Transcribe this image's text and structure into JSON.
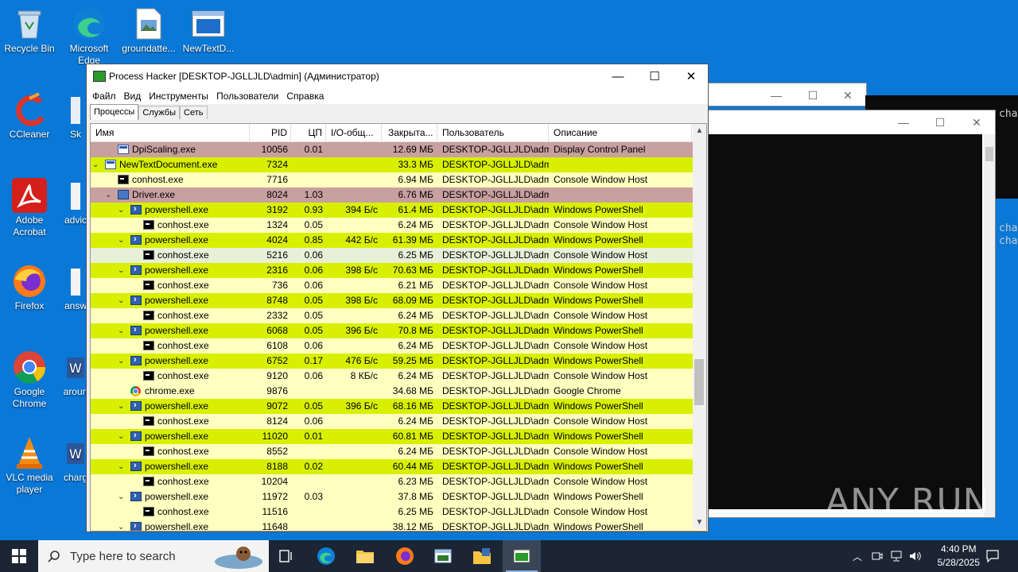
{
  "desktop": {
    "icons": [
      {
        "label": "Recycle Bin"
      },
      {
        "label": "Microsoft Edge"
      },
      {
        "label": "groundatte..."
      },
      {
        "label": "NewTextD..."
      },
      {
        "label": "CCleaner"
      },
      {
        "label": "Sk"
      },
      {
        "label": "Adobe Acrobat"
      },
      {
        "label": "advic"
      },
      {
        "label": "Firefox"
      },
      {
        "label": "answ"
      },
      {
        "label": "Google Chrome"
      },
      {
        "label": "aroun"
      },
      {
        "label": "VLC media player"
      },
      {
        "label": "charg"
      }
    ]
  },
  "background_console": {
    "lines": [
      "cha",
      "cha",
      "cha"
    ]
  },
  "window": {
    "title": "Process Hacker [DESKTOP-JGLLJLD\\admin] (Администратор)",
    "menu": [
      "Файл",
      "Вид",
      "Инструменты",
      "Пользователи",
      "Справка"
    ],
    "tabs": [
      "Процессы",
      "Службы",
      "Сеть"
    ],
    "columns": {
      "name": "Имя",
      "pid": "PID",
      "cpu": "ЦП",
      "io": "I/O-общ...",
      "mem": "Закрыта...",
      "user": "Пользователь",
      "desc": "Описание"
    },
    "rows": [
      {
        "name": "DpiScaling.exe",
        "pid": "10056",
        "cpu": "0.01",
        "io": "",
        "mem": "12.69 МБ",
        "user": "DESKTOP-JGLLJLD\\admi",
        "desc": "Display Control Panel",
        "level": 3,
        "icon": "win",
        "toggle": "",
        "color": "#c8a0a0"
      },
      {
        "name": "NewTextDocument.exe",
        "pid": "7324",
        "cpu": "",
        "io": "",
        "mem": "33.3 МБ",
        "user": "DESKTOP-JGLLJLD\\admi",
        "desc": "",
        "level": 2,
        "icon": "win",
        "toggle": "v",
        "color": "#d8f000"
      },
      {
        "name": "conhost.exe",
        "pid": "7716",
        "cpu": "",
        "io": "",
        "mem": "6.94 МБ",
        "user": "DESKTOP-JGLLJLD\\admi",
        "desc": "Console Window Host",
        "level": 3,
        "icon": "con",
        "toggle": "",
        "color": "#ffffc0"
      },
      {
        "name": "Driver.exe",
        "pid": "8024",
        "cpu": "1.03",
        "io": "",
        "mem": "6.76 МБ",
        "user": "DESKTOP-JGLLJLD\\admi",
        "desc": "",
        "level": 3,
        "icon": "drv",
        "toggle": "v",
        "color": "#c8a0a0"
      },
      {
        "name": "powershell.exe",
        "pid": "3192",
        "cpu": "0.93",
        "io": "394 Б/с",
        "mem": "61.4 МБ",
        "user": "DESKTOP-JGLLJLD\\admi",
        "desc": "Windows PowerShell",
        "level": 4,
        "icon": "ps",
        "toggle": "v",
        "color": "#d8f000"
      },
      {
        "name": "conhost.exe",
        "pid": "1324",
        "cpu": "0.05",
        "io": "",
        "mem": "6.24 МБ",
        "user": "DESKTOP-JGLLJLD\\admi",
        "desc": "Console Window Host",
        "level": 5,
        "icon": "con",
        "toggle": "",
        "color": "#ffffc0"
      },
      {
        "name": "powershell.exe",
        "pid": "4024",
        "cpu": "0.85",
        "io": "442 Б/с",
        "mem": "61.39 МБ",
        "user": "DESKTOP-JGLLJLD\\admi",
        "desc": "Windows PowerShell",
        "level": 4,
        "icon": "ps",
        "toggle": "v",
        "color": "#d8f000"
      },
      {
        "name": "conhost.exe",
        "pid": "5216",
        "cpu": "0.06",
        "io": "",
        "mem": "6.25 МБ",
        "user": "DESKTOP-JGLLJLD\\admi",
        "desc": "Console Window Host",
        "level": 5,
        "icon": "con",
        "toggle": "",
        "color": "#e8f0d8"
      },
      {
        "name": "powershell.exe",
        "pid": "2316",
        "cpu": "0.06",
        "io": "398 Б/с",
        "mem": "70.63 МБ",
        "user": "DESKTOP-JGLLJLD\\admi",
        "desc": "Windows PowerShell",
        "level": 4,
        "icon": "ps",
        "toggle": "v",
        "color": "#d8f000"
      },
      {
        "name": "conhost.exe",
        "pid": "736",
        "cpu": "0.06",
        "io": "",
        "mem": "6.21 МБ",
        "user": "DESKTOP-JGLLJLD\\admi",
        "desc": "Console Window Host",
        "level": 5,
        "icon": "con",
        "toggle": "",
        "color": "#ffffc0"
      },
      {
        "name": "powershell.exe",
        "pid": "8748",
        "cpu": "0.05",
        "io": "398 Б/с",
        "mem": "68.09 МБ",
        "user": "DESKTOP-JGLLJLD\\admi",
        "desc": "Windows PowerShell",
        "level": 4,
        "icon": "ps",
        "toggle": "v",
        "color": "#d8f000"
      },
      {
        "name": "conhost.exe",
        "pid": "2332",
        "cpu": "0.05",
        "io": "",
        "mem": "6.24 МБ",
        "user": "DESKTOP-JGLLJLD\\admi",
        "desc": "Console Window Host",
        "level": 5,
        "icon": "con",
        "toggle": "",
        "color": "#ffffc0"
      },
      {
        "name": "powershell.exe",
        "pid": "6068",
        "cpu": "0.05",
        "io": "396 Б/с",
        "mem": "70.8 МБ",
        "user": "DESKTOP-JGLLJLD\\admi",
        "desc": "Windows PowerShell",
        "level": 4,
        "icon": "ps",
        "toggle": "v",
        "color": "#d8f000"
      },
      {
        "name": "conhost.exe",
        "pid": "6108",
        "cpu": "0.06",
        "io": "",
        "mem": "6.24 МБ",
        "user": "DESKTOP-JGLLJLD\\admi",
        "desc": "Console Window Host",
        "level": 5,
        "icon": "con",
        "toggle": "",
        "color": "#ffffc0"
      },
      {
        "name": "powershell.exe",
        "pid": "6752",
        "cpu": "0.17",
        "io": "476 Б/с",
        "mem": "59.25 МБ",
        "user": "DESKTOP-JGLLJLD\\admi",
        "desc": "Windows PowerShell",
        "level": 4,
        "icon": "ps",
        "toggle": "v",
        "color": "#d8f000"
      },
      {
        "name": "conhost.exe",
        "pid": "9120",
        "cpu": "0.06",
        "io": "8 КБ/с",
        "mem": "6.24 МБ",
        "user": "DESKTOP-JGLLJLD\\admi",
        "desc": "Console Window Host",
        "level": 5,
        "icon": "con",
        "toggle": "",
        "color": "#ffffc0"
      },
      {
        "name": "chrome.exe",
        "pid": "9876",
        "cpu": "",
        "io": "",
        "mem": "34.68 МБ",
        "user": "DESKTOP-JGLLJLD\\admi",
        "desc": "Google Chrome",
        "level": 4,
        "icon": "chr",
        "toggle": "",
        "color": "#ffffc0"
      },
      {
        "name": "powershell.exe",
        "pid": "9072",
        "cpu": "0.05",
        "io": "396 Б/с",
        "mem": "68.16 МБ",
        "user": "DESKTOP-JGLLJLD\\admi",
        "desc": "Windows PowerShell",
        "level": 4,
        "icon": "ps",
        "toggle": "v",
        "color": "#d8f000"
      },
      {
        "name": "conhost.exe",
        "pid": "8124",
        "cpu": "0.06",
        "io": "",
        "mem": "6.24 МБ",
        "user": "DESKTOP-JGLLJLD\\admi",
        "desc": "Console Window Host",
        "level": 5,
        "icon": "con",
        "toggle": "",
        "color": "#ffffc0"
      },
      {
        "name": "powershell.exe",
        "pid": "11020",
        "cpu": "0.01",
        "io": "",
        "mem": "60.81 МБ",
        "user": "DESKTOP-JGLLJLD\\admi",
        "desc": "Windows PowerShell",
        "level": 4,
        "icon": "ps",
        "toggle": "v",
        "color": "#d8f000"
      },
      {
        "name": "conhost.exe",
        "pid": "8552",
        "cpu": "",
        "io": "",
        "mem": "6.24 МБ",
        "user": "DESKTOP-JGLLJLD\\admi",
        "desc": "Console Window Host",
        "level": 5,
        "icon": "con",
        "toggle": "",
        "color": "#ffffc0"
      },
      {
        "name": "powershell.exe",
        "pid": "8188",
        "cpu": "0.02",
        "io": "",
        "mem": "60.44 МБ",
        "user": "DESKTOP-JGLLJLD\\admi",
        "desc": "Windows PowerShell",
        "level": 4,
        "icon": "ps",
        "toggle": "v",
        "color": "#d8f000"
      },
      {
        "name": "conhost.exe",
        "pid": "10204",
        "cpu": "",
        "io": "",
        "mem": "6.23 МБ",
        "user": "DESKTOP-JGLLJLD\\admi",
        "desc": "Console Window Host",
        "level": 5,
        "icon": "con",
        "toggle": "",
        "color": "#ffffc0"
      },
      {
        "name": "powershell.exe",
        "pid": "11972",
        "cpu": "0.03",
        "io": "",
        "mem": "37.8 МБ",
        "user": "DESKTOP-JGLLJLD\\admi",
        "desc": "Windows PowerShell",
        "level": 4,
        "icon": "ps",
        "toggle": "v",
        "color": "#ffffc0"
      },
      {
        "name": "conhost.exe",
        "pid": "11516",
        "cpu": "",
        "io": "",
        "mem": "6.25 МБ",
        "user": "DESKTOP-JGLLJLD\\admi",
        "desc": "Console Window Host",
        "level": 5,
        "icon": "con",
        "toggle": "",
        "color": "#ffffc0"
      },
      {
        "name": "powershell.exe",
        "pid": "11648",
        "cpu": "",
        "io": "",
        "mem": "38.12 МБ",
        "user": "DESKTOP-JGLLJLD\\admi",
        "desc": "Windows PowerShell",
        "level": 4,
        "icon": "ps",
        "toggle": "v",
        "color": "#ffffc0"
      }
    ]
  },
  "taskbar": {
    "search_placeholder": "Type here to search",
    "time": "4:40 PM",
    "date": "5/28/2025"
  },
  "watermark": "ANY RUN"
}
